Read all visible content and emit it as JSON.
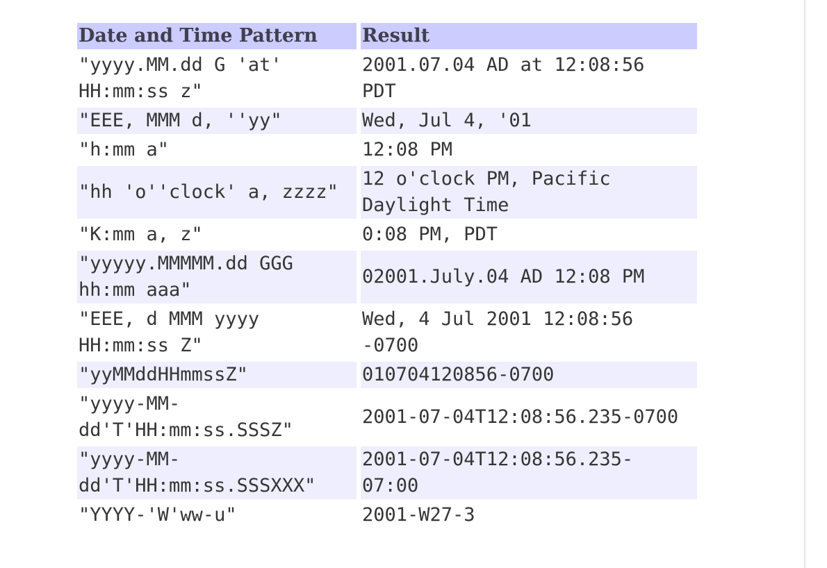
{
  "table": {
    "headers": [
      "Date and Time Pattern",
      "Result"
    ],
    "rows": [
      {
        "pattern": "\"yyyy.MM.dd G 'at'\nHH:mm:ss z\"",
        "result": "2001.07.04 AD at 12:08:56\nPDT"
      },
      {
        "pattern": "\"EEE, MMM d, ''yy\"",
        "result": "Wed, Jul 4, '01"
      },
      {
        "pattern": "\"h:mm a\"",
        "result": "12:08 PM"
      },
      {
        "pattern": "\"hh 'o''clock' a, zzzz\"",
        "result": "12 o'clock PM, Pacific\nDaylight Time"
      },
      {
        "pattern": "\"K:mm a, z\"",
        "result": "0:08 PM, PDT"
      },
      {
        "pattern": "\"yyyyy.MMMMM.dd GGG\nhh:mm aaa\"",
        "result": "02001.July.04 AD 12:08 PM"
      },
      {
        "pattern": "\"EEE, d MMM yyyy\nHH:mm:ss Z\"",
        "result": "Wed, 4 Jul 2001 12:08:56\n-0700"
      },
      {
        "pattern": "\"yyMMddHHmmssZ\"",
        "result": "010704120856-0700"
      },
      {
        "pattern": "\"yyyy-MM-\ndd'T'HH:mm:ss.SSSZ\"",
        "result": "2001-07-04T12:08:56.235-0700"
      },
      {
        "pattern": "\"yyyy-MM-\ndd'T'HH:mm:ss.SSSXXX\"",
        "result": "2001-07-04T12:08:56.235-\n07:00"
      },
      {
        "pattern": "\"YYYY-'W'ww-u\"",
        "result": "2001-W27-3"
      }
    ]
  }
}
